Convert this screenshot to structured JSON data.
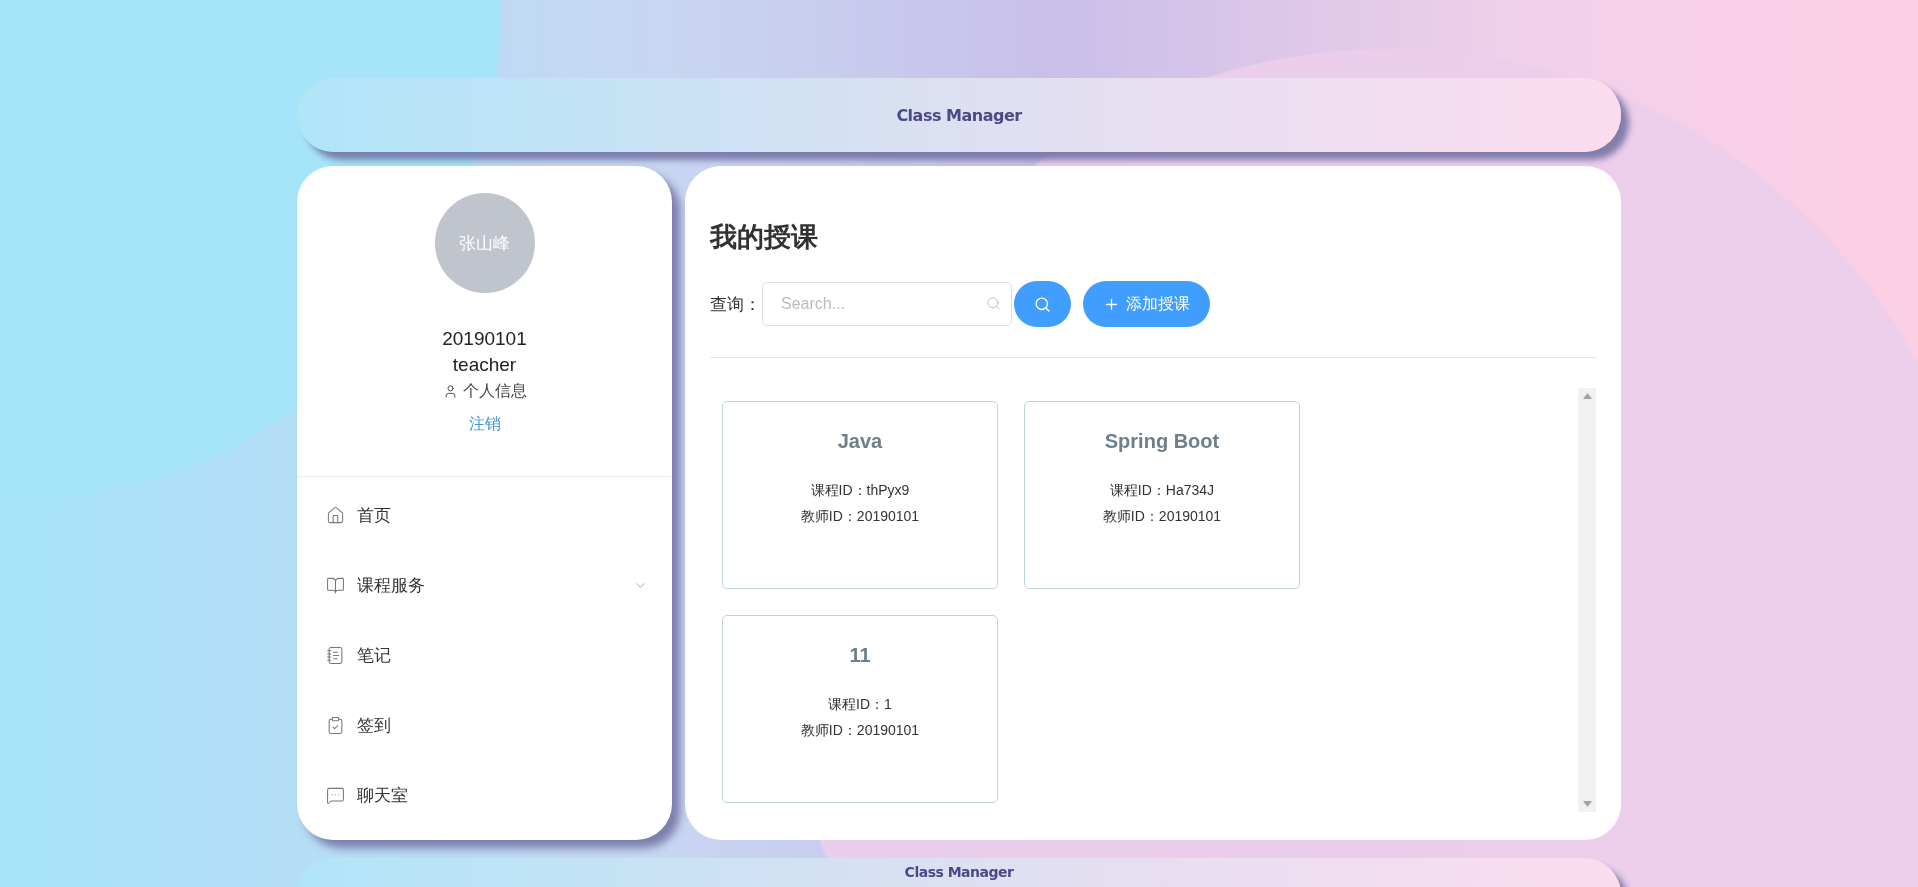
{
  "header": {
    "title": "Class Manager"
  },
  "profile": {
    "avatar_text": "张山峰",
    "user_id": "20190101",
    "role": "teacher",
    "info_link": "个人信息",
    "logout": "注销"
  },
  "menu": [
    {
      "kind": "home",
      "label": "首页",
      "has_submenu": false
    },
    {
      "kind": "book",
      "label": "课程服务",
      "has_submenu": true
    },
    {
      "kind": "notebook",
      "label": "笔记",
      "has_submenu": false
    },
    {
      "kind": "clipboard",
      "label": "签到",
      "has_submenu": false
    },
    {
      "kind": "chat",
      "label": "聊天室",
      "has_submenu": false
    }
  ],
  "main": {
    "title": "我的授课",
    "query_label": "查询：",
    "search": {
      "placeholder": "Search..."
    },
    "add_button": "添加授课",
    "courses": [
      {
        "name": "Java",
        "course_id": "课程ID：thPyx9",
        "teacher_id": "教师ID：20190101"
      },
      {
        "name": "Spring Boot",
        "course_id": "课程ID：Ha734J",
        "teacher_id": "教师ID：20190101"
      },
      {
        "name": "11",
        "course_id": "课程ID：1",
        "teacher_id": "教师ID：20190101"
      }
    ]
  },
  "footer_header": {
    "title": "Class Manager"
  }
}
